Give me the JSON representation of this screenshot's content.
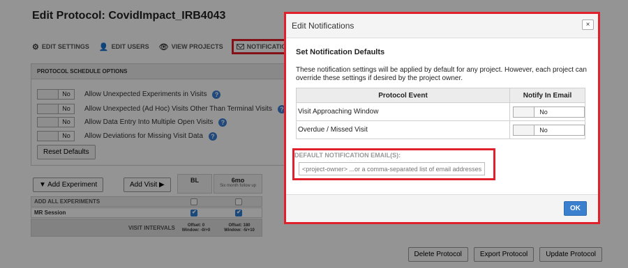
{
  "page": {
    "title": "Edit Protocol: CovidImpact_IRB4043"
  },
  "tabs": {
    "edit_settings": "EDIT SETTINGS",
    "edit_users": "EDIT USERS",
    "view_projects": "VIEW PROJECTS",
    "notifications": "NOTIFICATIONS"
  },
  "schedule": {
    "header": "PROTOCOL SCHEDULE OPTIONS",
    "no_label": "No",
    "options": [
      "Allow Unexpected Experiments in Visits",
      "Allow Unexpected (Ad Hoc) Visits Other Than Terminal Visits",
      "Allow Data Entry Into Multiple Open Visits",
      "Allow Deviations for Missing Visit Data"
    ],
    "reset_button": "Reset Defaults"
  },
  "experiments": {
    "add_experiment": "▼ Add Experiment",
    "add_visit": "Add Visit ▶",
    "col_bl": "BL",
    "col_6mo": "6mo",
    "col_6mo_sub": "Six month follow up",
    "add_all": "ADD ALL EXPERIMENTS",
    "mr_session": "MR Session",
    "visit_intervals": "VISIT INTERVALS",
    "offset_bl_1": "Offset: 0",
    "offset_bl_2": "Window: -0/+0",
    "offset_6mo_1": "Offset: 180",
    "offset_6mo_2": "Window: -5/+10"
  },
  "footer_buttons": {
    "delete": "Delete Protocol",
    "export": "Export Protocol",
    "update": "Update Protocol"
  },
  "modal": {
    "title": "Edit Notifications",
    "close": "×",
    "heading": "Set Notification Defaults",
    "description": "These notification settings will be applied by default for any project. However, each project can override these settings if desired by the project owner.",
    "table": {
      "col_event": "Protocol Event",
      "col_email": "Notify In Email",
      "rows": [
        {
          "event": "Visit Approaching Window",
          "value": "No"
        },
        {
          "event": "Overdue / Missed Visit",
          "value": "No"
        }
      ]
    },
    "email_label": "DEFAULT NOTIFICATION EMAIL(S):",
    "email_placeholder": "<project-owner> ...or a comma-separated list of email addresses",
    "ok": "OK"
  },
  "colors": {
    "highlight": "#e0202a",
    "primary": "#3a80cf",
    "help": "#3b7fd6"
  }
}
